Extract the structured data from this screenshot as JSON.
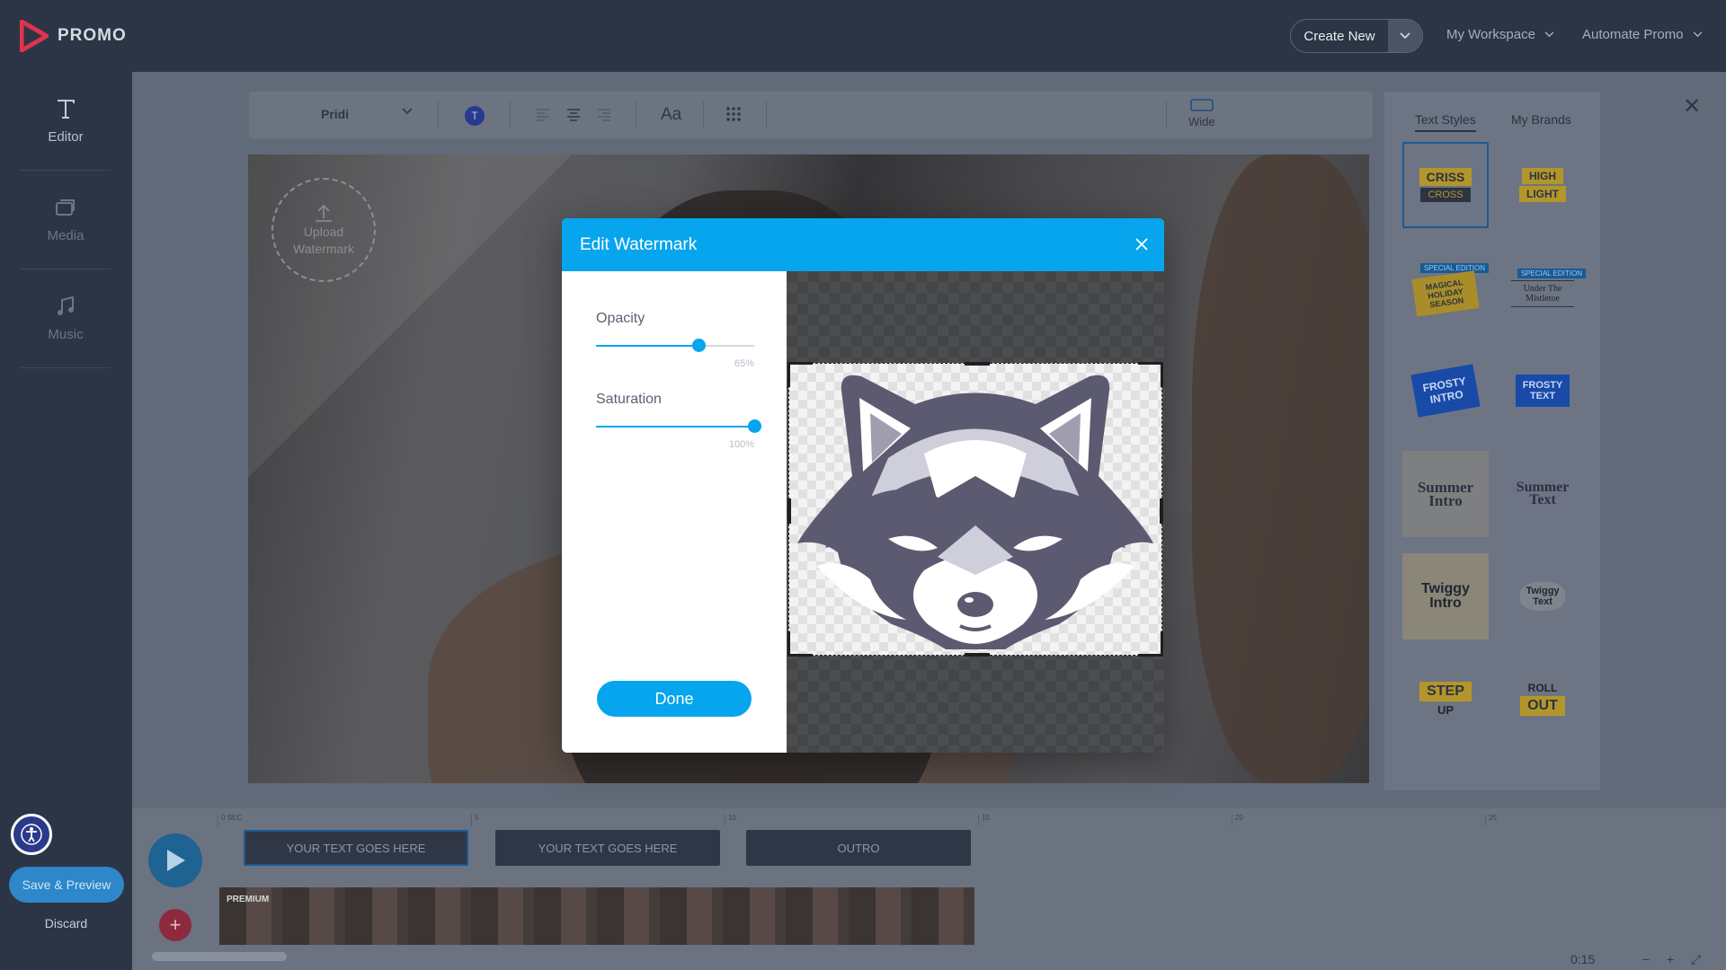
{
  "header": {
    "logo_text": "PROMO",
    "create_new": "Create New",
    "my_workspace": "My Workspace",
    "automate_promo": "Automate Promo"
  },
  "sidebar": {
    "items": [
      {
        "label": "Editor",
        "icon": "text-t-icon"
      },
      {
        "label": "Media",
        "icon": "media-icon"
      },
      {
        "label": "Music",
        "icon": "music-note-icon"
      }
    ],
    "save_preview": "Save & Preview",
    "discard": "Discard"
  },
  "toolbar": {
    "font": "Pridi",
    "text_color_initial": "T",
    "font_size_icon": "Aa",
    "aspect_label": "Wide"
  },
  "canvas": {
    "upload_watermark": "Upload Watermark"
  },
  "right_panel": {
    "tabs": [
      "Text Styles",
      "My Brands"
    ],
    "styles": [
      {
        "line1": "CRISS",
        "line2": "CROSS"
      },
      {
        "line1": "HIGH",
        "line2": "LIGHT"
      },
      {
        "line1": "MAGICAL HOLIDAY SEASON",
        "badge": "SPECIAL EDITION"
      },
      {
        "line1": "Under The Mistletoe",
        "badge": "SPECIAL EDITION"
      },
      {
        "line1": "FROSTY INTRO"
      },
      {
        "line1": "FROSTY TEXT"
      },
      {
        "line1": "Summer Intro"
      },
      {
        "line1": "Summer Text"
      },
      {
        "line1": "Twiggy Intro"
      },
      {
        "line1": "Twiggy Text"
      },
      {
        "line1": "STEP",
        "line2": "UP"
      },
      {
        "line1": "ROLL",
        "line2": "OUT"
      }
    ]
  },
  "timeline": {
    "ruler": [
      "0 SEC",
      "5",
      "10",
      "15",
      "20",
      "25"
    ],
    "clips": [
      "YOUR TEXT GOES HERE",
      "YOUR TEXT GOES HERE",
      "OUTRO"
    ],
    "premium": "PREMIUM",
    "time": "0:15"
  },
  "modal": {
    "title": "Edit Watermark",
    "opacity_label": "Opacity",
    "opacity_value": 65,
    "opacity_text": "65%",
    "saturation_label": "Saturation",
    "saturation_value": 100,
    "saturation_text": "100%",
    "done": "Done",
    "watermark_image": "raccoon-mascot-icon"
  },
  "colors": {
    "accent": "#06a5ed",
    "topbar": "#2c3545",
    "save_button": "#2d87c9"
  }
}
